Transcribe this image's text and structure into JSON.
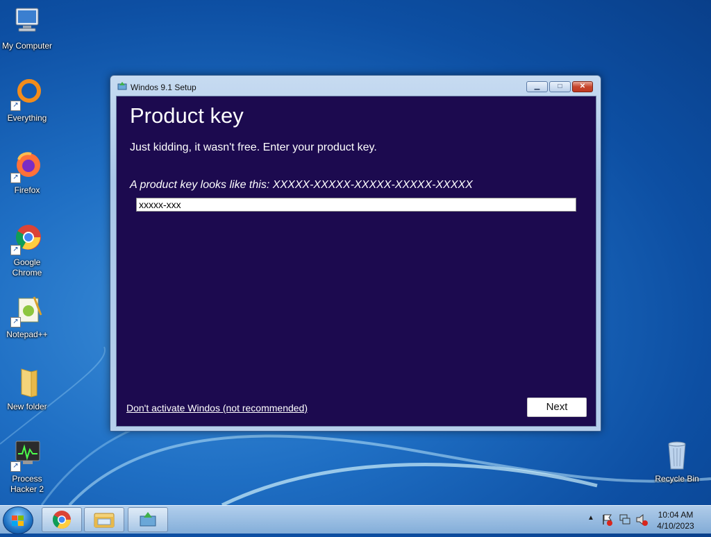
{
  "desktop": {
    "icons": [
      {
        "label": "My Computer"
      },
      {
        "label": "Everything"
      },
      {
        "label": "Firefox"
      },
      {
        "label": "Google Chrome"
      },
      {
        "label": "Notepad++"
      },
      {
        "label": "New folder"
      },
      {
        "label": "Process Hacker 2"
      },
      {
        "label": "Recycle Bin"
      }
    ]
  },
  "window": {
    "title": "Windos 9.1 Setup",
    "heading": "Product key",
    "subtext": "Just kidding, it wasn't free. Enter your product key.",
    "hint": "A product key looks like this: XXXXX-XXXXX-XXXXX-XXXXX-XXXXX",
    "key_value": "xxxxx-xxx",
    "skip_link": "Don't activate Windos (not recommended)",
    "next_label": "Next"
  },
  "taskbar": {
    "items": [
      "start-orb",
      "chrome-icon",
      "explorer-icon",
      "setup-icon"
    ],
    "tray_icons": [
      "show-hidden-icon",
      "action-center-icon",
      "network-icon",
      "volume-muted-icon"
    ],
    "time": "10:04 AM",
    "date": "4/10/2023"
  },
  "colors": {
    "client_bg": "#1c0a4f",
    "close_red": "#c7462d"
  }
}
